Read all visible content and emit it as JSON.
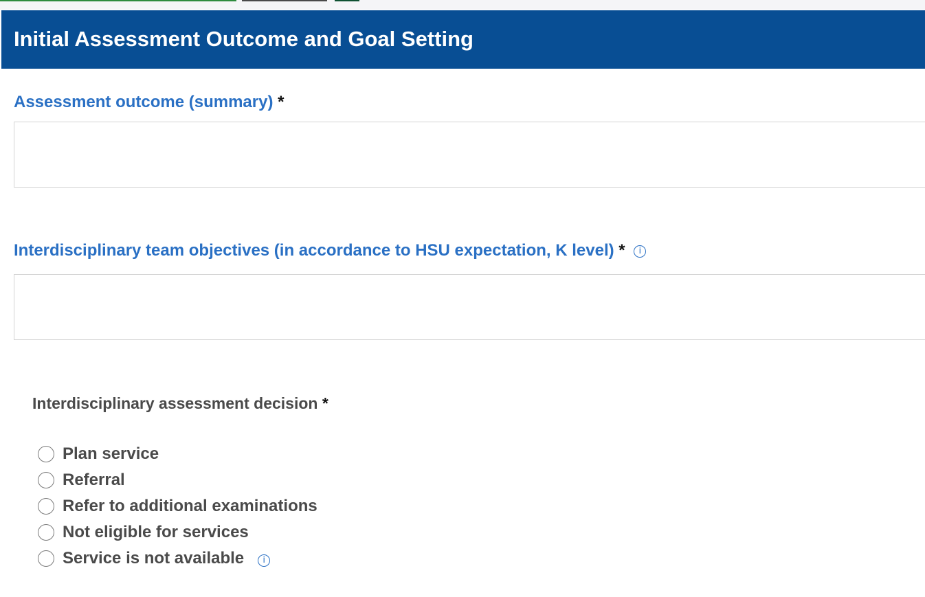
{
  "header": {
    "title": "Initial Assessment Outcome and Goal Setting"
  },
  "fields": {
    "assessment_outcome": {
      "label": "Assessment outcome (summary)",
      "required_marker": "*",
      "value": ""
    },
    "team_objectives": {
      "label": "Interdisciplinary team objectives (in accordance to HSU expectation, K level)",
      "required_marker": "*",
      "info_icon": "info-icon",
      "value": ""
    }
  },
  "decision": {
    "label": "Interdisciplinary assessment decision",
    "required_marker": "*",
    "options": [
      {
        "label": "Plan service",
        "selected": false
      },
      {
        "label": "Referral",
        "selected": false
      },
      {
        "label": "Refer to additional examinations",
        "selected": false
      },
      {
        "label": "Not eligible for services",
        "selected": false
      },
      {
        "label": "Service is not available",
        "selected": false,
        "info_icon": "info-icon"
      }
    ]
  },
  "colors": {
    "header_bg": "#084e94",
    "label_blue": "#2a70c4",
    "text_gray": "#4a4a4a"
  }
}
